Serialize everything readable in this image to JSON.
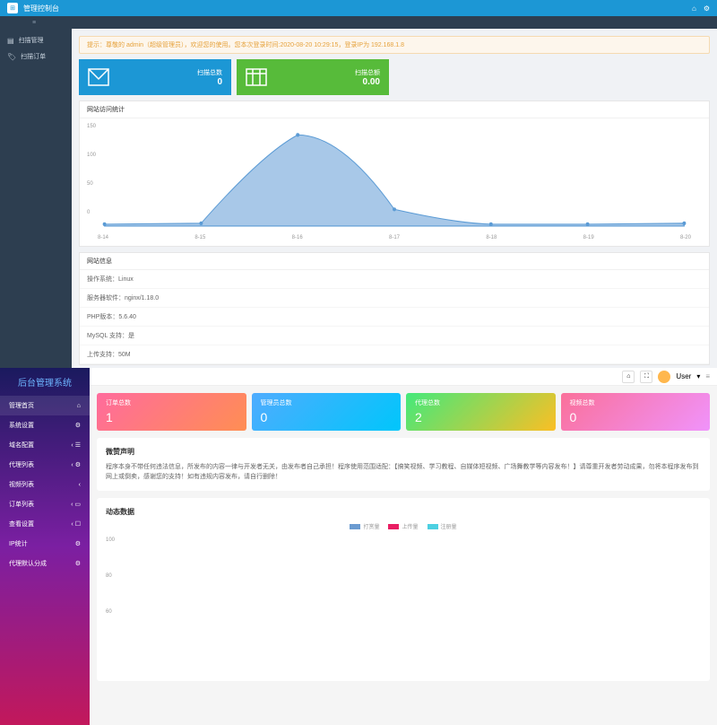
{
  "top": {
    "title": "管理控制台",
    "tab_icon": "≡",
    "sidebar": [
      {
        "icon": "▤",
        "label": "扫描管理"
      },
      {
        "icon": "🏷",
        "label": "扫描订单"
      }
    ],
    "alert": "提示：尊敬的 admin（超级管理员），欢迎您的使用。您本次登录时间:2020-08-20 10:29:15，登录IP为 192.168.1.8",
    "cards": [
      {
        "label": "扫描总数",
        "value": "0"
      },
      {
        "label": "扫描总额",
        "value": "0.00"
      }
    ],
    "chart": {
      "title": "网站访问统计",
      "x_labels": [
        "8-14",
        "8-15",
        "8-16",
        "8-17",
        "8-18",
        "8-19",
        "8-20"
      ],
      "y_labels": [
        "150",
        "100",
        "50",
        "0"
      ]
    },
    "info": {
      "title": "网站信息",
      "rows": [
        "操作系统：Linux",
        "服务器软件：nginx/1.18.0",
        "PHP版本：5.6.40",
        "MySQL 支持：是",
        "上传支持：50M"
      ]
    }
  },
  "bot": {
    "brand": "后台管理系统",
    "user": "User",
    "menu": [
      {
        "label": "管理首页",
        "icon": "⌂",
        "active": true
      },
      {
        "label": "系统设置",
        "icon": "⚙"
      },
      {
        "label": "域名配置",
        "icon": "‹",
        "r": "☰"
      },
      {
        "label": "代理列表",
        "icon": "‹",
        "r": "⚙"
      },
      {
        "label": "视频列表",
        "icon": "‹"
      },
      {
        "label": "订单列表",
        "icon": "‹",
        "r": "▭"
      },
      {
        "label": "查看设置",
        "icon": "‹",
        "r": "☐"
      },
      {
        "label": "IP统计",
        "icon": "",
        "r": "⚙"
      },
      {
        "label": "代理默认分成",
        "icon": "",
        "r": "⚙"
      }
    ],
    "cards": [
      {
        "label": "订单总数",
        "value": "1"
      },
      {
        "label": "管理员总数",
        "value": "0"
      },
      {
        "label": "代理总数",
        "value": "2"
      },
      {
        "label": "视频总数",
        "value": "0"
      }
    ],
    "notice": {
      "title": "微赞声明",
      "text": "程序本身不带任何违法信息，所发布的内容一律与开发者无关，由发布者自己承担！程序使用范围适配：【搞笑视频、学习教程、自媒体短视频、广场舞教学等内容发布！】请尊重开发者劳动成果，勿将本程序发布到网上或倒卖，感谢您的支持！如有违规内容发布，请自行删除！"
    },
    "chart": {
      "title": "动态数据",
      "legend": [
        {
          "label": "打赏量",
          "color": "#6b9bd1"
        },
        {
          "label": "上传量",
          "color": "#e91e63"
        },
        {
          "label": "注册量",
          "color": "#4dd0e1"
        }
      ],
      "y_labels": [
        "100",
        "80",
        "60"
      ]
    }
  },
  "chart_data": [
    {
      "type": "area",
      "title": "网站访问统计",
      "x": [
        "8-14",
        "8-15",
        "8-16",
        "8-17",
        "8-18",
        "8-19",
        "8-20"
      ],
      "values": [
        2,
        3,
        140,
        25,
        3,
        2,
        3
      ],
      "ylim": [
        0,
        150
      ]
    },
    {
      "type": "line",
      "title": "动态数据",
      "series": [
        {
          "name": "打赏量",
          "values": []
        },
        {
          "name": "上传量",
          "values": []
        },
        {
          "name": "注册量",
          "values": []
        }
      ],
      "ylim": [
        60,
        100
      ]
    }
  ]
}
